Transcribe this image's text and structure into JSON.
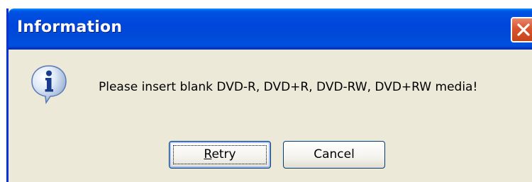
{
  "window": {
    "title": "Information"
  },
  "message": {
    "text": "Please insert blank DVD-R, DVD+R, DVD-RW, DVD+RW media!",
    "icon": "info-icon"
  },
  "buttons": {
    "retry_accel": "R",
    "retry_rest": "etry",
    "cancel_label": "Cancel"
  },
  "icons": {
    "close": "close-icon",
    "info": "information-icon"
  },
  "colors": {
    "titlebar": "#0055ea",
    "dialog_bg": "#ece9d8",
    "close_button": "#d9542c"
  }
}
